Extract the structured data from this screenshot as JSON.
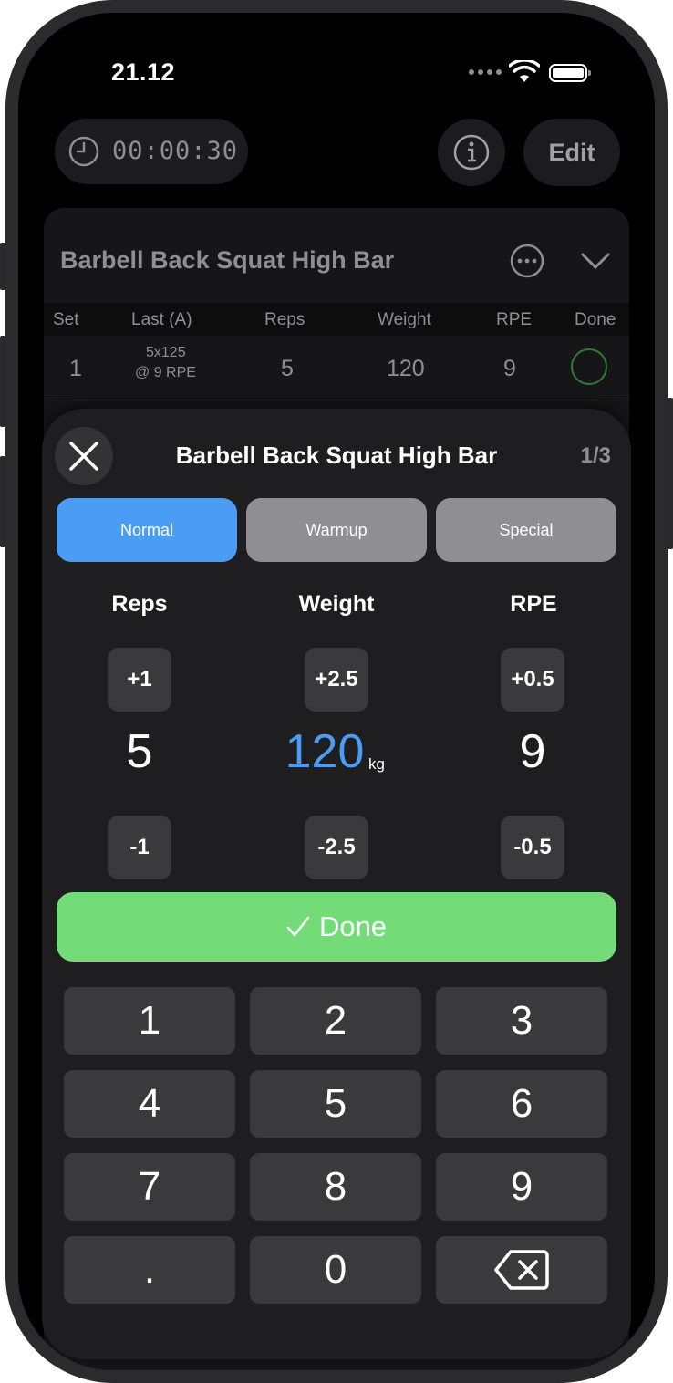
{
  "status": {
    "time": "21.12"
  },
  "toolbar": {
    "timer": "00:00:30",
    "edit_label": "Edit"
  },
  "exercise_card": {
    "title": "Barbell Back Squat High Bar",
    "headers": [
      "Set",
      "Last (A)",
      "Reps",
      "Weight",
      "RPE",
      "Done"
    ],
    "rows": [
      {
        "set": "1",
        "last_line1": "5x125",
        "last_line2": "@ 9 RPE",
        "reps": "5",
        "weight": "120",
        "rpe": "9"
      }
    ]
  },
  "sheet": {
    "title": "Barbell Back Squat High Bar",
    "counter": "1/3",
    "tabs": [
      {
        "label": "Normal",
        "active": true
      },
      {
        "label": "Warmup",
        "active": false
      },
      {
        "label": "Special",
        "active": false
      }
    ],
    "columns": {
      "reps": {
        "label": "Reps",
        "plus": "+1",
        "value": "5",
        "minus": "-1"
      },
      "weight": {
        "label": "Weight",
        "plus": "+2.5",
        "value": "120",
        "unit": "kg",
        "minus": "-2.5"
      },
      "rpe": {
        "label": "RPE",
        "plus": "+0.5",
        "value": "9",
        "minus": "-0.5"
      }
    },
    "done_label": "Done",
    "keypad": [
      "1",
      "2",
      "3",
      "4",
      "5",
      "6",
      "7",
      "8",
      "9",
      ".",
      "0"
    ]
  },
  "colors": {
    "accent": "#4a9cf5",
    "done_green": "#73db78",
    "inactive_tab": "#8e8e93"
  },
  "icons": [
    "clock-icon",
    "info-icon",
    "more-icon",
    "chevron-down-icon",
    "close-icon",
    "checkmark-icon",
    "backspace-icon",
    "wifi-icon",
    "battery-icon"
  ]
}
